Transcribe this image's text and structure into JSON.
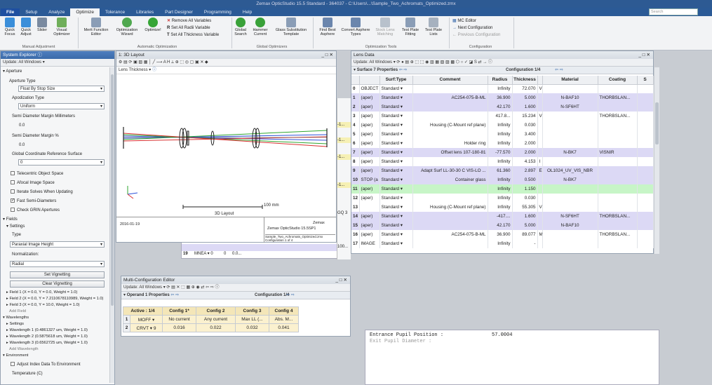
{
  "window": {
    "title": "Zemax OpticStudio 15.5    Standard - 364037 - C:\\Users\\...\\Sample_Two_Achromats_Optimized.zmx",
    "search": "Search"
  },
  "tabs": [
    "File",
    "Setup",
    "Analyze",
    "Optimize",
    "Tolerance",
    "Libraries",
    "Part Designer",
    "Programming",
    "Help"
  ],
  "ribbon": {
    "manual_adjustment": {
      "group": "Manual Adjustment",
      "buttons": [
        "Quick Focus",
        "Quick Adjust",
        "Slider",
        "Visual Optimizer"
      ]
    },
    "automatic_optimization": {
      "group": "Automatic Optimization",
      "buttons": [
        "Merit Function Editor",
        "Optimization Wizard",
        "Optimize!"
      ],
      "small": [
        "Remove All Variables",
        "Set All Radii Variable",
        "Set All Thickness Variable"
      ]
    },
    "global_optimizers": {
      "group": "Global Optimizers",
      "buttons": [
        "Global Search",
        "Hammer Current",
        "Glass Substitution Template"
      ]
    },
    "optimization_tools": {
      "group": "Optimization Tools",
      "buttons": [
        "Find Best Asphere",
        "Convert Asphere Types",
        "Stock Lens Matching",
        "Test Plate Fitting",
        "Test Plate Lists"
      ]
    },
    "configuration": {
      "group": "Configuration",
      "small": [
        "MC Editor",
        "Next Configuration",
        "Previous Configuration"
      ]
    }
  },
  "system_explorer": {
    "title": "System Explorer ⓘ",
    "update": "Update: All Windows ▾",
    "aperture_header": "Aperture",
    "aperture_type_label": "Aperture Type",
    "aperture_type_value": "Float By Stop Size",
    "apodization_label": "Apodization Type",
    "apodization_value": "Uniform",
    "semi_margin_mm_label": "Semi Diameter Margin Millimeters",
    "semi_margin_mm_value": "0.0",
    "semi_margin_pct_label": "Semi Diameter Margin %",
    "semi_margin_pct_value": "0.0",
    "gcr_label": "Global Coordinate Reference Surface",
    "gcr_value": "0",
    "checkboxes": [
      {
        "label": "Telecentric Object Space",
        "checked": false
      },
      {
        "label": "Afocal Image Space",
        "checked": false
      },
      {
        "label": "Iterate Solves When Updating",
        "checked": false
      },
      {
        "label": "Fast Semi-Diameters",
        "checked": true
      },
      {
        "label": "Check GRIN Apertures",
        "checked": false
      }
    ],
    "fields_header": "Fields",
    "settings_header": "Settings",
    "type_label": "Type",
    "type_value": "Paraxial Image Height",
    "normalization_label": "Normalization:",
    "normalization_value": "Radial",
    "set_vignetting": "Set Vignetting",
    "clear_vignetting": "Clear Vignetting",
    "fields": [
      "Field 1 (X = 0.0, Y = 0.0, Weight = 1.0)",
      "Field 2 (X = 0.0, Y = 7.2110678110989, Weight = 1.0)",
      "Field 3 (X = 0.0, Y = 10.0, Weight = 1.0)",
      "Add Field"
    ],
    "wavelengths_header": "Wavelengths",
    "wl_settings": "Settings",
    "wavelengths": [
      "Wavelength 1 (0.4861327 um, Weight = 1.0)",
      "Wavelength 2 (0.5875618 um, Weight = 1.0)",
      "Wavelength 3 (0.6562725 um, Weight = 1.0)",
      "Add Wavelength"
    ],
    "environment_header": "Environment",
    "adjust_index": "Adjust Index Data To Environment",
    "temperature": "Temperature (C)"
  },
  "layout": {
    "title": "1: 3D Layout",
    "toolbar_label": "Lens Thickness ▾",
    "scale_label": "100 mm",
    "caption": "3D Layout",
    "footer_date": "2016-01-19",
    "footer_company": "Zemax",
    "footer_product": "Zemax OpticStudio 15.5SP1",
    "footer_file": "Sample_Two_Achromats_Optimized.zmx\nConfiguration 1 of 4"
  },
  "lens_data": {
    "title": "Lens Data",
    "update": "Update: All Windows ▾",
    "surface_props": "Surface 7 Properties",
    "config": "Configuration 1/4",
    "columns": [
      "Surf:Type",
      "Comment",
      "Radius",
      "Thickness",
      "Material",
      "Coating",
      "S"
    ],
    "rows": [
      {
        "n": "0",
        "label": "OBJECT",
        "type": "Standard ▾",
        "comment": "",
        "radius": "Infinity",
        "thick": "72.070",
        "tf": "V",
        "material": "",
        "coating": "",
        "style": "white"
      },
      {
        "n": "1",
        "label": "(aper)",
        "type": "Standard ▾",
        "comment": "AC254-075-B-ML",
        "radius": "36.900",
        "thick": "5.000",
        "tf": "",
        "material": "N-BAF10",
        "coating": "THORBSLAN...",
        "style": "purple"
      },
      {
        "n": "2",
        "label": "(aper)",
        "type": "Standard ▾",
        "comment": "",
        "radius": "42.170",
        "thick": "1.600",
        "tf": "",
        "material": "N-SF6HT",
        "coating": "",
        "style": "purple"
      },
      {
        "n": "3",
        "label": "(aper)",
        "type": "Standard ▾",
        "comment": "",
        "radius": "417.8...",
        "thick": "15.234",
        "tf": "V",
        "material": "",
        "coating": "THORBSLAN...",
        "style": "white"
      },
      {
        "n": "4",
        "label": "(aper)",
        "type": "Standard ▾",
        "comment": "Housing (C-Mount ref plane)",
        "radius": "Infinity",
        "thick": "0.030",
        "tf": "",
        "material": "",
        "coating": "",
        "style": "white"
      },
      {
        "n": "5",
        "label": "(aper)",
        "type": "Standard ▾",
        "comment": "",
        "radius": "Infinity",
        "thick": "3.400",
        "tf": "",
        "material": "",
        "coating": "",
        "style": "white"
      },
      {
        "n": "6",
        "label": "(aper)",
        "type": "Standard ▾",
        "comment": "Holder ring",
        "radius": "Infinity",
        "thick": "2.000",
        "tf": "",
        "material": "",
        "coating": "",
        "style": "white"
      },
      {
        "n": "7",
        "label": "(aper)",
        "type": "Standard ▾",
        "comment": "Offset lens 107-180-81",
        "radius": "-77.570",
        "thick": "2.000",
        "tf": "",
        "material": "N-BK7",
        "coating": "VISNIR",
        "style": "purple"
      },
      {
        "n": "8",
        "label": "(aper)",
        "type": "Standard ▾",
        "comment": "",
        "radius": "Infinity",
        "thick": "4.153",
        "tf": "I",
        "material": "",
        "coating": "",
        "style": "white"
      },
      {
        "n": "9",
        "label": "(aper)",
        "type": "Standard ▾",
        "comment": "Adapt Surf LL-30-30 C VIS-LO ...",
        "radius": "61.360",
        "thick": "2.897",
        "tf": "E",
        "material": "OL1024_UV_VIS_NBR",
        "coating": "",
        "style": "purple"
      },
      {
        "n": "10",
        "label": "STOP (a",
        "type": "Standard ▾",
        "comment": "Container glass",
        "radius": "Infinity",
        "thick": "0.500",
        "tf": "",
        "material": "N-BK7",
        "coating": "",
        "style": "purple"
      },
      {
        "n": "11",
        "label": "(aper)",
        "type": "Standard ▾",
        "comment": "",
        "radius": "Infinity",
        "thick": "1.150",
        "tf": "",
        "material": "",
        "coating": "",
        "style": "green"
      },
      {
        "n": "12",
        "label": "(aper)",
        "type": "Standard ▾",
        "comment": "",
        "radius": "Infinity",
        "thick": "0.030",
        "tf": "",
        "material": "",
        "coating": "",
        "style": "white"
      },
      {
        "n": "13",
        "label": "",
        "type": "Standard ▾",
        "comment": "Housing (C-Mount ref plane)",
        "radius": "Infinity",
        "thick": "55.305",
        "tf": "V",
        "material": "",
        "coating": "",
        "style": "white"
      },
      {
        "n": "14",
        "label": "(aper)",
        "type": "Standard ▾",
        "comment": "",
        "radius": "-417....",
        "thick": "1.600",
        "tf": "",
        "material": "N-SF6HT",
        "coating": "THORBSLAN...",
        "style": "purple"
      },
      {
        "n": "15",
        "label": "(aper)",
        "type": "Standard ▾",
        "comment": "",
        "radius": "42.170",
        "thick": "5.000",
        "tf": "",
        "material": "N-BAF10",
        "coating": "",
        "style": "purple"
      },
      {
        "n": "16",
        "label": "(aper)",
        "type": "Standard ▾",
        "comment": "AC254-075-B-ML",
        "radius": "36.900",
        "thick": "89.077",
        "tf": "M",
        "material": "",
        "coating": "THORBSLAN...",
        "style": "white"
      },
      {
        "n": "17",
        "label": "IMAGE",
        "type": "Standard ▾",
        "comment": "",
        "radius": "Infinity",
        "thick": "-",
        "tf": "",
        "material": "",
        "coating": "",
        "style": "white"
      }
    ]
  },
  "mce": {
    "title": "Multi-Configuration Editor",
    "update": "Update: All Windows ▾",
    "operand_props": "Operand 1 Properties",
    "config": "Configuration 1/4",
    "headers": [
      "Active : 1/4",
      "Config 1*",
      "Config 2",
      "Config 3",
      "Config 4"
    ],
    "rows": [
      {
        "n": "1",
        "op": "MOFF ▾",
        "cells": [
          "No current",
          "Any current",
          "Max LL (...",
          "Abs. M..."
        ]
      },
      {
        "n": "2",
        "op": "CRVT ▾ 9",
        "cells": [
          "0.016",
          "0.022",
          "0.032",
          "0.041"
        ]
      }
    ]
  },
  "background": {
    "mfe_row": {
      "n": "19",
      "op": "MNEA ▾ 0",
      "v1": "0",
      "v2": "0.0...",
      "v3": "100..."
    },
    "side_vals": [
      "-1...",
      "-1...",
      "-1...",
      "-1...",
      "GQ 3",
      "100..."
    ],
    "text_line1": "Entrance Pupil Position :",
    "text_val1": "57.0004",
    "text_line2": "Exit Pupil Diameter :",
    "text_val2": "..."
  }
}
